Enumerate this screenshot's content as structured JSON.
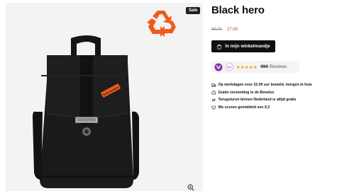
{
  "product": {
    "badge": "Sale",
    "title": "Black hero",
    "price_old": "89,00",
    "price_new": "27,00",
    "cart_button": "In mijn winkelmandje",
    "bag_tag_text": "bold banana"
  },
  "reviews": {
    "score": "9,1",
    "count": "494",
    "label": "Reviews",
    "stars": 5
  },
  "usps": [
    {
      "icon": "truck-icon",
      "text": "Op werkdagen voor 22.00 uur besteld, morgen in huis"
    },
    {
      "icon": "clock-icon",
      "text": "Gratis verzending in de Benelux"
    },
    {
      "icon": "return-icon",
      "text": "Terugsturen binnen Nederland is altijd gratis"
    },
    {
      "icon": "heart-icon",
      "text": "We scoren gemiddeld een 9,3"
    }
  ],
  "colors": {
    "accent_orange": "#f05a1a",
    "button_dark": "#0f0f14",
    "sale_price": "#d0312d",
    "stars": "#f2b01e",
    "kiyoh_purple": "#7a37a8"
  }
}
